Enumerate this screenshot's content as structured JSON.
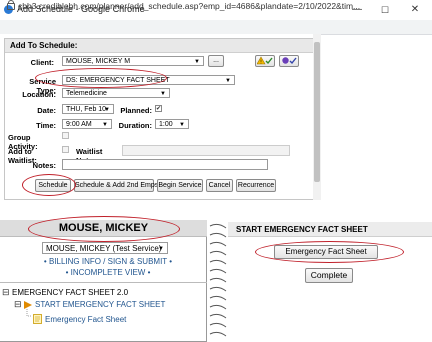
{
  "window": {
    "title": "Add Schedule - Google Chrome",
    "url": "cbh3.crediblebh.com/planner/add_schedule.asp?emp_id=4686&plandate=2/10/2022&tim...",
    "minimize": "—",
    "maximize": "☐",
    "close": "✕"
  },
  "dialog": {
    "header": "Add To Schedule:",
    "client_label": "Client:",
    "client_value": "MOUSE, MICKEY M",
    "ellipsis_label": "...",
    "service_type_label": "Service Type:",
    "service_type_value": "DS: EMERGENCY FACT SHEET",
    "location_label": "Location:",
    "location_value": "Telemedicine",
    "date_label": "Date:",
    "date_value": "THU, Feb 10",
    "planned_label": "Planned:",
    "planned_checked": true,
    "time_label": "Time:",
    "time_value": "9:00 AM",
    "duration_label": "Duration:",
    "duration_value": "1:00",
    "group_activity_label": "Group Activity:",
    "add_waitlist_label": "Add to Waitlist:",
    "waitlist_notes_label": "Waitlist Notes:",
    "notes_label": "Notes:",
    "buttons": {
      "schedule": "Schedule",
      "schedule_add": "Schedule & Add 2nd Emps",
      "begin_service": "Begin Service",
      "cancel": "Cancel",
      "recurrence": "Recurrence"
    },
    "check_glyph": "✔"
  },
  "left_panel": {
    "patient_name": "MOUSE, MICKEY",
    "client_select": "MOUSE, MICKEY (Test Service)",
    "billing_link": "BILLING INFO / SIGN & SUBMIT",
    "incomplete_link": "INCOMPLETE VIEW",
    "bullet": "•",
    "tree_root": "EMERGENCY FACT SHEET 2.0",
    "tree_child": "START EMERGENCY FACT SHEET",
    "tree_leaf": "Emergency Fact Sheet",
    "expander": "⊟"
  },
  "right_panel": {
    "header": "START EMERGENCY FACT SHEET",
    "form_button": "Emergency Fact Sheet",
    "complete_button": "Complete"
  },
  "colors": {
    "highlight_ring": "#c0202a",
    "link": "#22568f",
    "arrow_orange": "#e08a00"
  }
}
